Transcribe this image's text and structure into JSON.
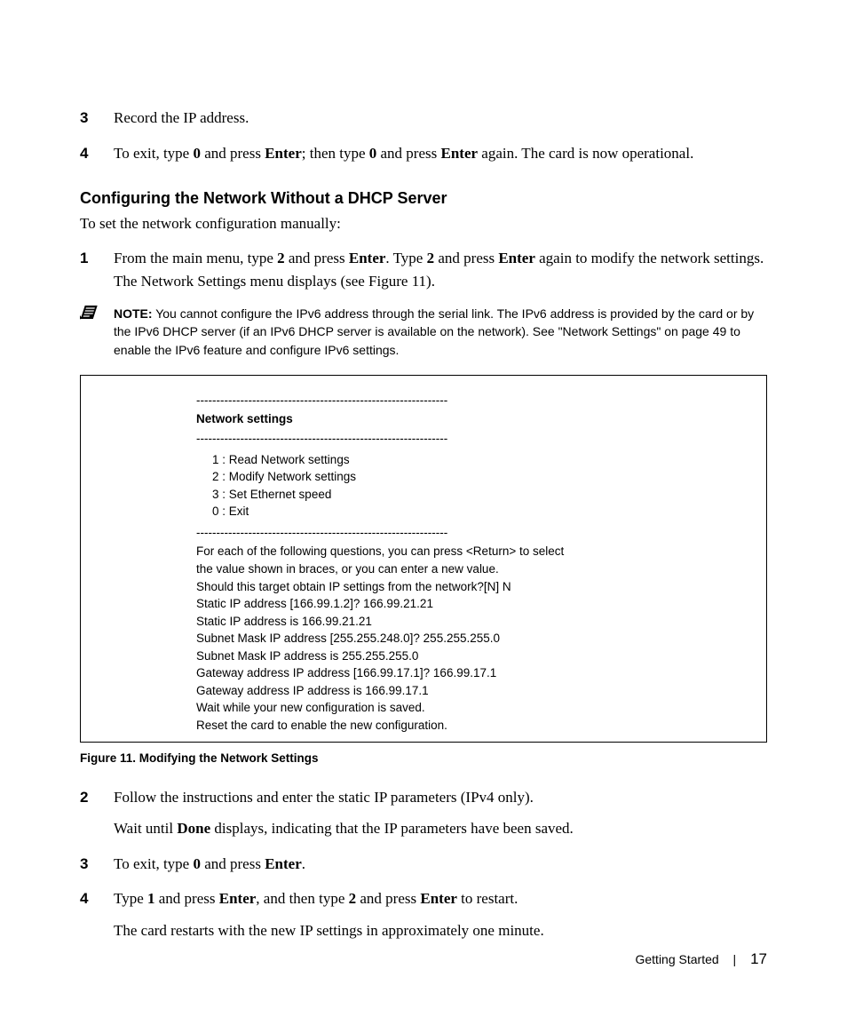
{
  "steps_top": [
    {
      "num": "3",
      "body": [
        {
          "runs": [
            {
              "t": "Record the IP address."
            }
          ]
        }
      ]
    },
    {
      "num": "4",
      "body": [
        {
          "runs": [
            {
              "t": "To exit, type "
            },
            {
              "t": "0",
              "b": true
            },
            {
              "t": " and press "
            },
            {
              "t": "Enter",
              "b": true
            },
            {
              "t": "; then type "
            },
            {
              "t": "0",
              "b": true
            },
            {
              "t": " and press "
            },
            {
              "t": "Enter",
              "b": true
            },
            {
              "t": " again. The card is now operational."
            }
          ]
        }
      ]
    }
  ],
  "heading": "Configuring the Network Without a DHCP Server",
  "intro": "To set the network configuration manually:",
  "step_mid": {
    "num": "1",
    "body": [
      {
        "runs": [
          {
            "t": "From the main menu, type "
          },
          {
            "t": "2",
            "b": true
          },
          {
            "t": " and press "
          },
          {
            "t": "Enter",
            "b": true
          },
          {
            "t": ". Type "
          },
          {
            "t": "2",
            "b": true
          },
          {
            "t": " and press "
          },
          {
            "t": "Enter",
            "b": true
          },
          {
            "t": " again to modify the network settings. The Network Settings menu displays (see Figure 11)."
          }
        ]
      }
    ]
  },
  "note": {
    "label": "NOTE:",
    "text": " You cannot configure the IPv6 address through the serial link. The IPv6 address is provided by the card or by the IPv6 DHCP server (if an IPv6 DHCP server is available on the network). See \"Network Settings\" on page 49 to enable the IPv6 feature and configure IPv6 settings."
  },
  "figure": {
    "divider": "---------------------------------------------------------------",
    "title": "Network settings",
    "menu": [
      "1 : Read Network settings",
      "2 : Modify Network settings",
      "3 : Set Ethernet speed",
      "0 : Exit"
    ],
    "lines": [
      "For each of the following questions, you can press <Return> to select",
      "the value shown in braces, or you can enter a new value.",
      "Should this target obtain IP settings from the network?[N] N",
      "Static IP address [166.99.1.2]? 166.99.21.21",
      "Static IP address is 166.99.21.21",
      "Subnet Mask IP address [255.255.248.0]? 255.255.255.0",
      "Subnet Mask IP address is 255.255.255.0",
      "Gateway address IP address [166.99.17.1]? 166.99.17.1",
      "Gateway address IP address is 166.99.17.1",
      "Wait while your new configuration is saved.",
      "Reset the card to enable the new configuration."
    ],
    "caption": "Figure 11. Modifying the Network Settings"
  },
  "steps_bottom": [
    {
      "num": "2",
      "body": [
        {
          "runs": [
            {
              "t": "Follow the instructions and enter the static IP parameters (IPv4 only)."
            }
          ]
        },
        {
          "runs": [
            {
              "t": "Wait until "
            },
            {
              "t": "Done",
              "b": true
            },
            {
              "t": " displays, indicating that the IP parameters have been saved."
            }
          ]
        }
      ]
    },
    {
      "num": "3",
      "body": [
        {
          "runs": [
            {
              "t": "To exit, type "
            },
            {
              "t": "0",
              "b": true
            },
            {
              "t": " and press "
            },
            {
              "t": "Enter",
              "b": true
            },
            {
              "t": "."
            }
          ]
        }
      ]
    },
    {
      "num": "4",
      "body": [
        {
          "runs": [
            {
              "t": "Type "
            },
            {
              "t": "1",
              "b": true
            },
            {
              "t": " and press "
            },
            {
              "t": "Enter",
              "b": true
            },
            {
              "t": ", and then type "
            },
            {
              "t": "2",
              "b": true
            },
            {
              "t": " and press "
            },
            {
              "t": "Enter",
              "b": true
            },
            {
              "t": " to restart."
            }
          ]
        },
        {
          "runs": [
            {
              "t": "The card restarts with the new IP settings in approximately one minute."
            }
          ]
        }
      ]
    }
  ],
  "footer": {
    "section": "Getting Started",
    "sep": "|",
    "page": "17"
  }
}
